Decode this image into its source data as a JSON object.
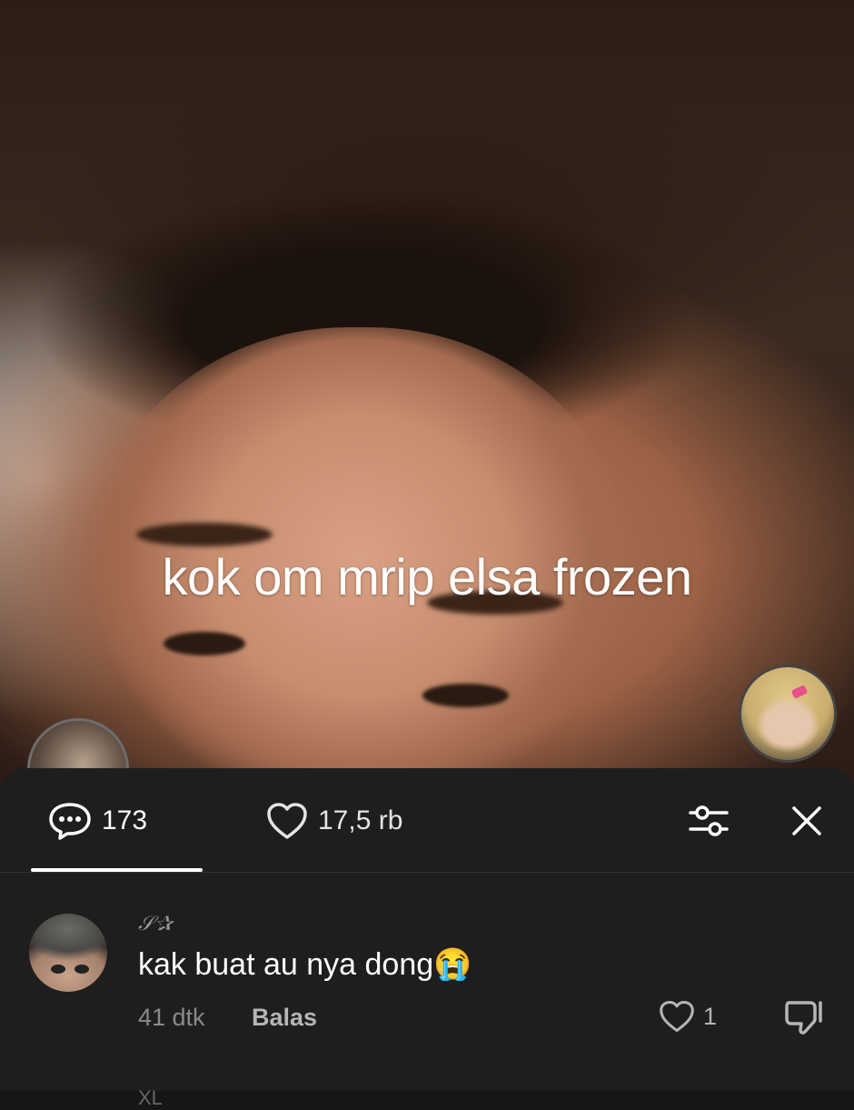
{
  "video": {
    "caption": "kok om mrip elsa frozen"
  },
  "sheet": {
    "tabs": {
      "comments_icon": "speech-bubble-icon",
      "comments_count": "173",
      "likes_icon": "heart-icon",
      "likes_count": "17,5 rb"
    },
    "filter_icon": "sliders-icon",
    "close_icon": "close-icon"
  },
  "comment": {
    "username": "𝒮✰",
    "text": "kak buat au nya dong😭",
    "time": "41 dtk",
    "reply_label": "Balas",
    "like_count": "1",
    "next_username": "XL"
  },
  "colors": {
    "sheet_bg": "#1e1e1e",
    "muted_text": "#8a8a8a",
    "underline": "#ffffff"
  }
}
